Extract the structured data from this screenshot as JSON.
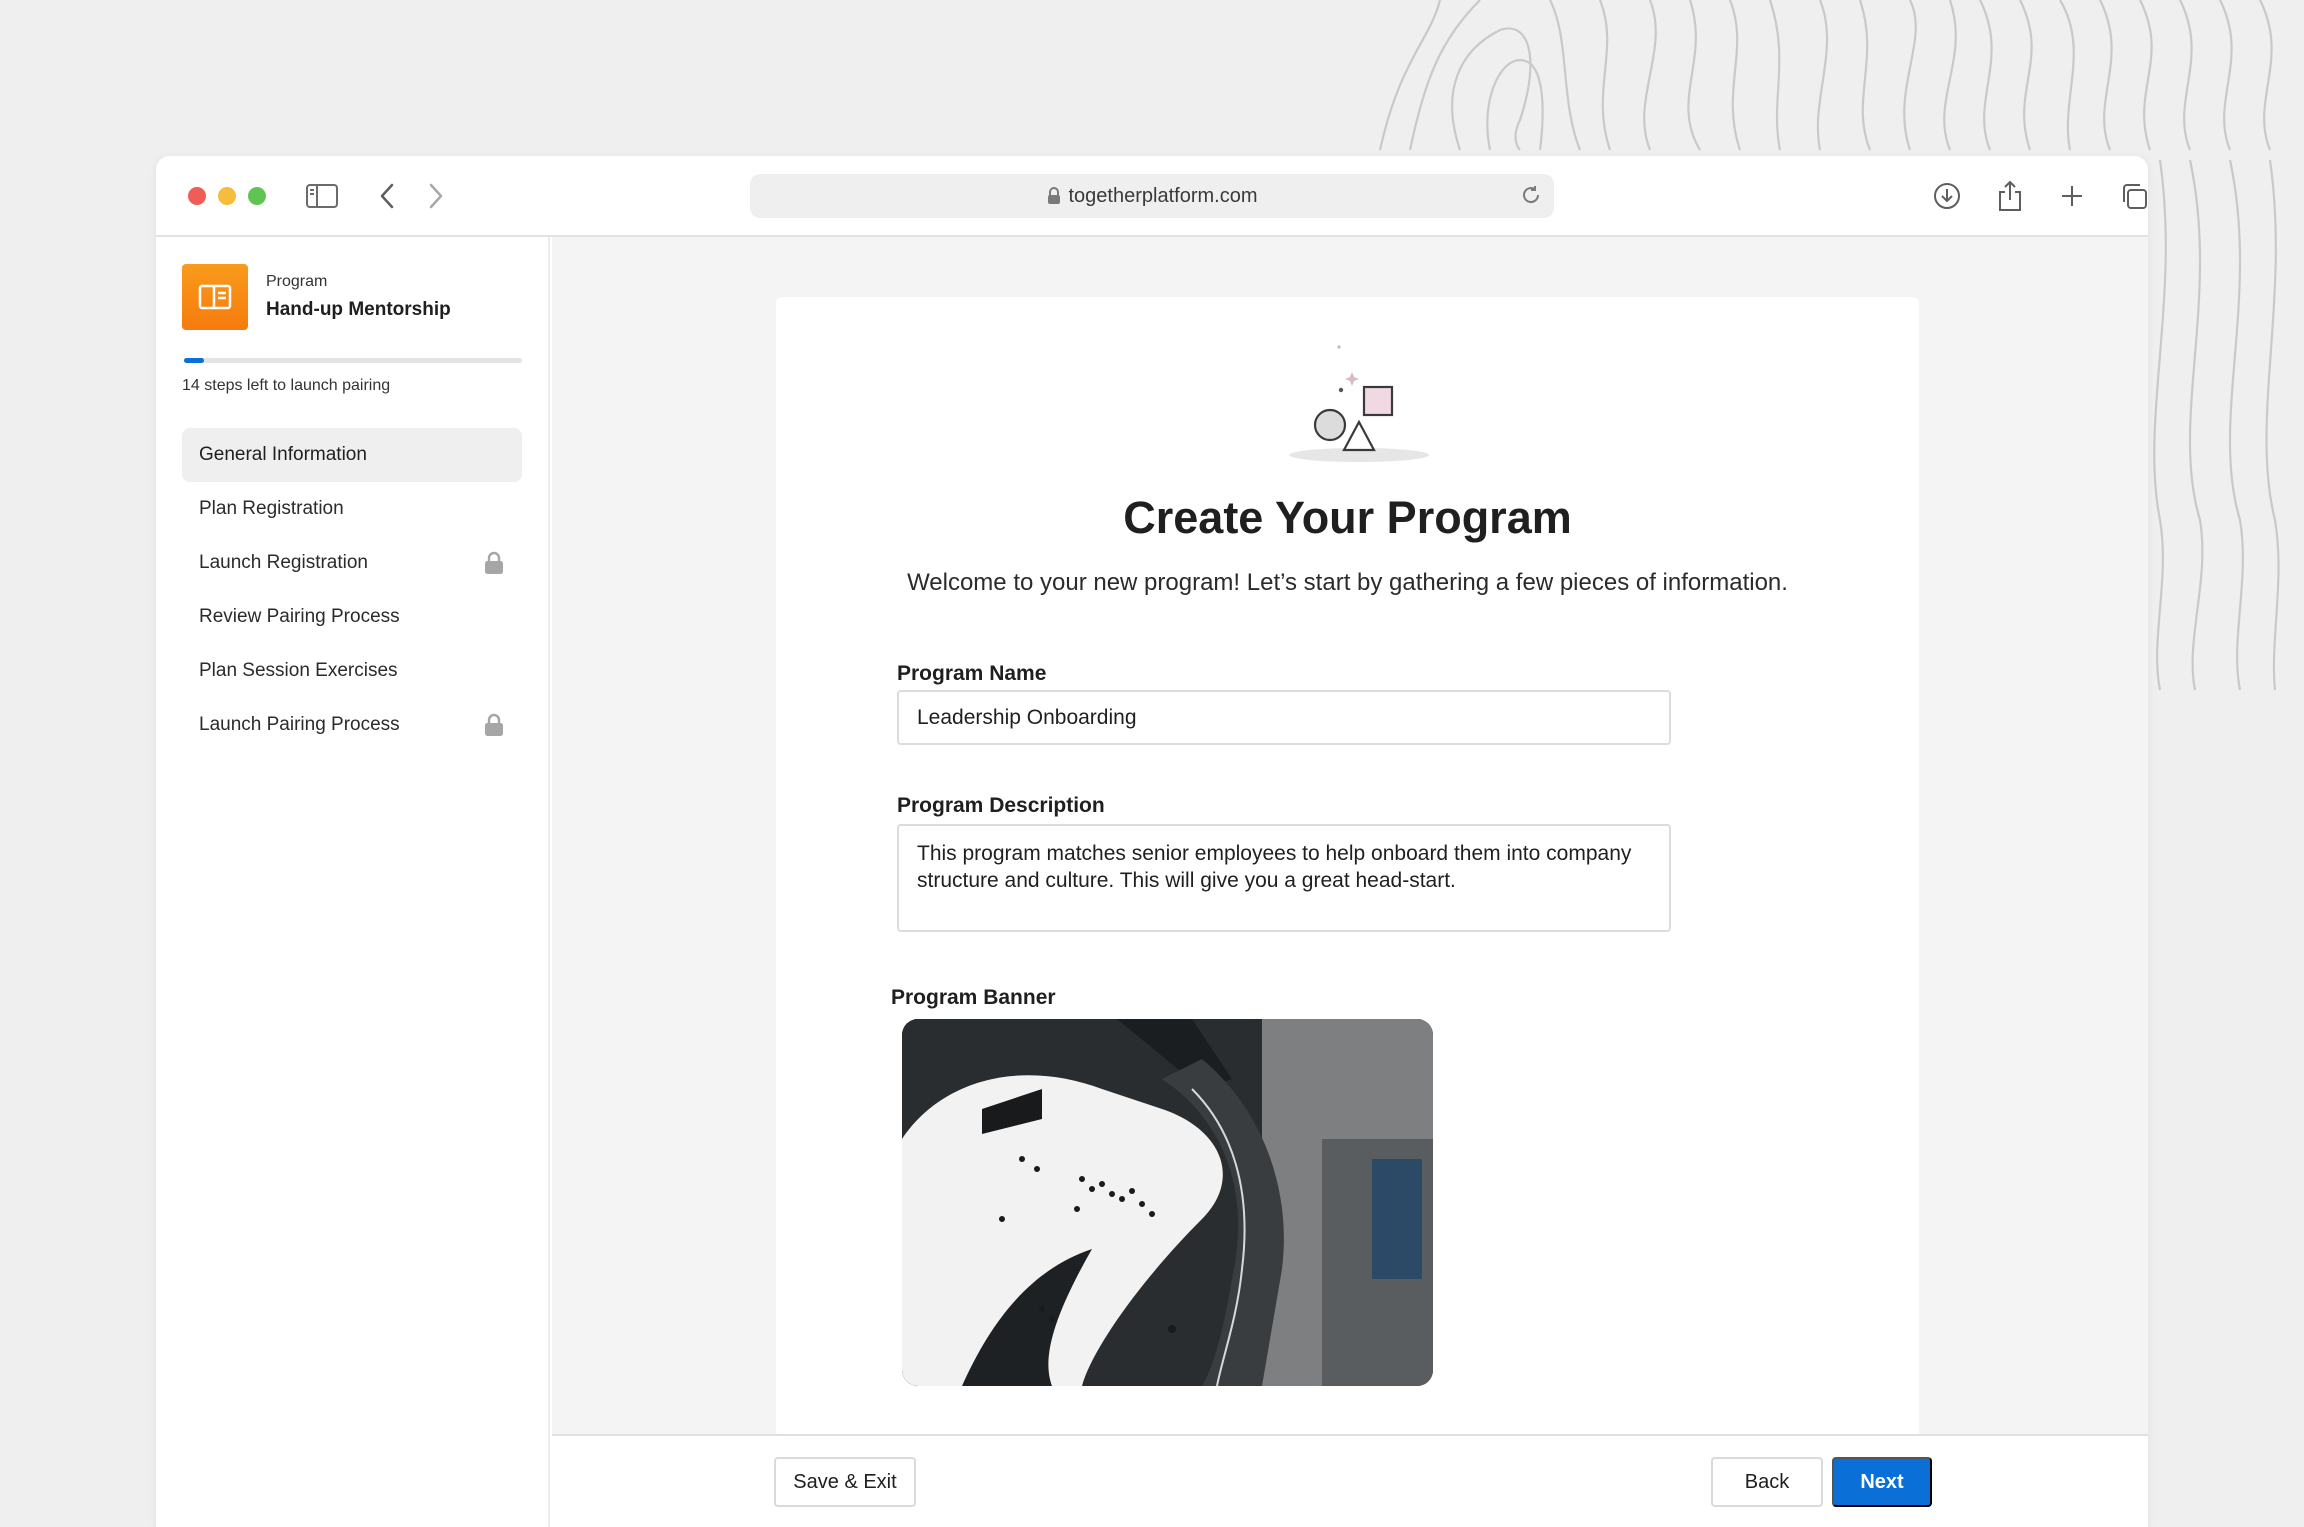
{
  "browser": {
    "url": "togetherplatform.com"
  },
  "sidebar": {
    "program_kicker": "Program",
    "program_name": "Hand-up Mentorship",
    "progress_fraction": 0.06,
    "steps_left": "14 steps left to launch pairing",
    "items": [
      {
        "label": "General Information",
        "active": true,
        "locked": false
      },
      {
        "label": "Plan Registration",
        "active": false,
        "locked": false
      },
      {
        "label": "Launch Registration",
        "active": false,
        "locked": true
      },
      {
        "label": "Review Pairing Process",
        "active": false,
        "locked": false
      },
      {
        "label": "Plan Session Exercises",
        "active": false,
        "locked": false
      },
      {
        "label": "Launch Pairing Process",
        "active": false,
        "locked": true
      }
    ]
  },
  "main": {
    "title": "Create Your Program",
    "subtitle": "Welcome to your new program! Let’s start by gathering a few pieces of information.",
    "program_name_label": "Program Name",
    "program_name_value": "Leadership Onboarding",
    "program_description_label": "Program Description",
    "program_description_value": "This program matches senior employees to help onboard them into company structure and culture. This will give you a great head-start.",
    "program_banner_label": "Program Banner"
  },
  "footer": {
    "save_exit": "Save & Exit",
    "back": "Back",
    "next": "Next"
  },
  "colors": {
    "accent": "#0a6fd6",
    "program_tile": "#f68a15"
  }
}
